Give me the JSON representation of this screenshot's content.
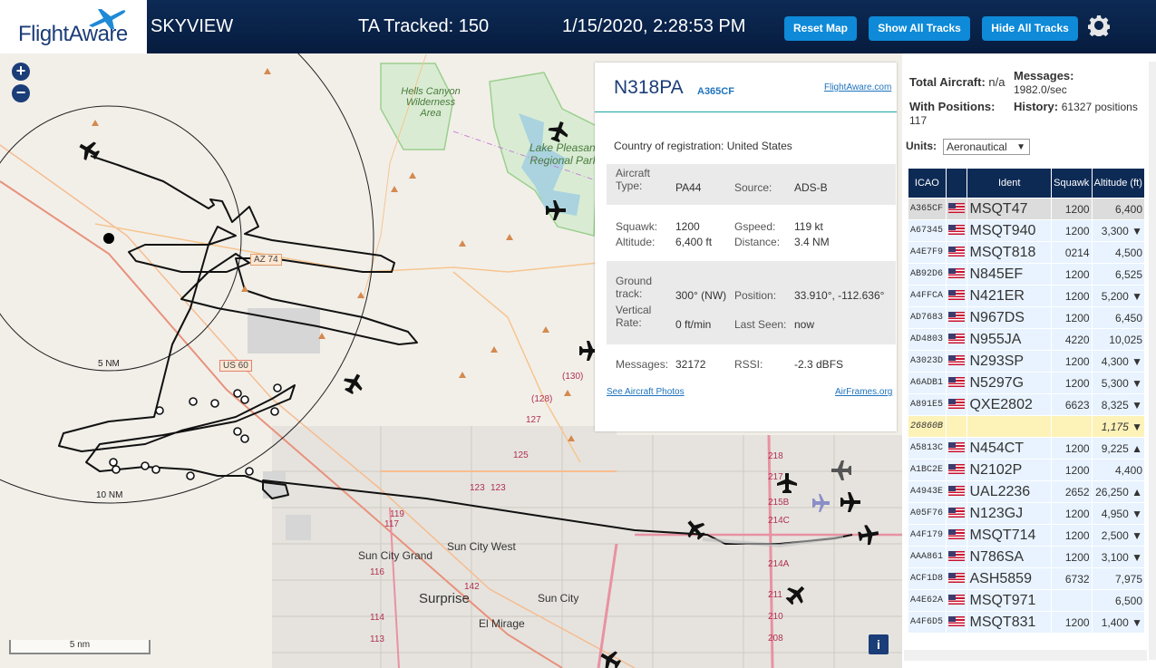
{
  "header": {
    "logo_text": "FlightAware",
    "app_name": "SKYVIEW",
    "tracked": "TA Tracked: 150",
    "datetime": "1/15/2020, 2:28:53 PM",
    "buttons": {
      "reset": "Reset Map",
      "show": "Show All Tracks",
      "hide": "Hide All Tracks"
    }
  },
  "map": {
    "zoom_in": "+",
    "zoom_out": "−",
    "labels": {
      "hells_canyon": "Hells Canyon Wilderness Area",
      "lake_pleasant": "Lake Pleasant Regional Park",
      "az74": "AZ 74",
      "us60": "US 60",
      "ring5": "5 NM",
      "ring10": "10 NM",
      "sun_city_grand": "Sun City Grand",
      "sun_city_west": "Sun City West",
      "surprise": "Surprise",
      "sun_city": "Sun City",
      "el_mirage": "El Mirage",
      "r128": "(128)",
      "r130": "(130)",
      "r127": "127",
      "r125": "125",
      "r123a": "123",
      "r123b": "123",
      "r119": "119",
      "r117": "117",
      "r116": "116",
      "r114": "114",
      "r113": "113",
      "r142": "142",
      "r218": "218",
      "r217": "217",
      "r215b": "215B",
      "r214c": "214C",
      "r214a": "214A",
      "r211": "211",
      "r210": "210",
      "r208": "208"
    },
    "scale": "5 nm",
    "info": "i"
  },
  "popup": {
    "callsign": "N318PA",
    "icao": "A365CF",
    "link_fa": "FlightAware.com",
    "country_label": "Country of registration:",
    "country": "United States",
    "type_label": "Aircraft Type:",
    "type": "PA44",
    "source_label": "Source:",
    "source": "ADS-B",
    "squawk_label": "Squawk:",
    "squawk": "1200",
    "gspeed_label": "Gspeed:",
    "gspeed": "119 kt",
    "altitude_label": "Altitude:",
    "altitude": "6,400 ft",
    "distance_label": "Distance:",
    "distance": "3.4 NM",
    "track_label": "Ground track:",
    "track": "300° (NW)",
    "position_label": "Position:",
    "position": "33.910°, -112.636°",
    "vrate_label": "Vertical Rate:",
    "vrate": "0 ft/min",
    "lastseen_label": "Last Seen:",
    "lastseen": "now",
    "messages_label": "Messages:",
    "messages": "32172",
    "rssi_label": "RSSI:",
    "rssi": "-2.3 dBFS",
    "photos_link": "See Aircraft Photos",
    "airframes_link": "AirFrames.org"
  },
  "sidebar": {
    "total_label": "Total Aircraft:",
    "total": "n/a",
    "messages_label": "Messages:",
    "messages": "1982.0/sec",
    "withpos_label": "With Positions:",
    "withpos": "117",
    "history_label": "History:",
    "history": "61327 positions",
    "units_label": "Units:",
    "units_value": "Aeronautical",
    "columns": [
      "ICAO",
      "",
      "Ident",
      "Squawk",
      "Altitude (ft)"
    ],
    "rows": [
      {
        "icao": "A365CF",
        "ident": "MSQT47",
        "squawk": "1200",
        "alt": "6,400"
      },
      {
        "icao": "A67345",
        "ident": "MSQT940",
        "squawk": "1200",
        "alt": "3,300 ▼"
      },
      {
        "icao": "A4E7F9",
        "ident": "MSQT818",
        "squawk": "0214",
        "alt": "4,500"
      },
      {
        "icao": "AB92D6",
        "ident": "N845EF",
        "squawk": "1200",
        "alt": "6,525"
      },
      {
        "icao": "A4FFCA",
        "ident": "N421ER",
        "squawk": "1200",
        "alt": "5,200 ▼"
      },
      {
        "icao": "AD7683",
        "ident": "N967DS",
        "squawk": "1200",
        "alt": "6,450"
      },
      {
        "icao": "AD4803",
        "ident": "N955JA",
        "squawk": "4220",
        "alt": "10,025"
      },
      {
        "icao": "A3023D",
        "ident": "N293SP",
        "squawk": "1200",
        "alt": "4,300 ▼"
      },
      {
        "icao": "A6ADB1",
        "ident": "N5297G",
        "squawk": "1200",
        "alt": "5,300 ▼"
      },
      {
        "icao": "A891E5",
        "ident": "QXE2802",
        "squawk": "6623",
        "alt": "8,325 ▼"
      },
      {
        "icao": "26860B",
        "ident": "",
        "squawk": "",
        "alt": "1,175 ▼"
      },
      {
        "icao": "A5813C",
        "ident": "N454CT",
        "squawk": "1200",
        "alt": "9,225 ▲"
      },
      {
        "icao": "A1BC2E",
        "ident": "N2102P",
        "squawk": "1200",
        "alt": "4,400"
      },
      {
        "icao": "A4943E",
        "ident": "UAL2236",
        "squawk": "2652",
        "alt": "26,250 ▲"
      },
      {
        "icao": "A05F76",
        "ident": "N123GJ",
        "squawk": "1200",
        "alt": "4,950 ▼"
      },
      {
        "icao": "A4F179",
        "ident": "MSQT714",
        "squawk": "1200",
        "alt": "2,500 ▼"
      },
      {
        "icao": "AAA861",
        "ident": "N786SA",
        "squawk": "1200",
        "alt": "3,100 ▼"
      },
      {
        "icao": "ACF1D8",
        "ident": "ASH5859",
        "squawk": "6732",
        "alt": "7,975"
      },
      {
        "icao": "A4E62A",
        "ident": "MSQT971",
        "squawk": "",
        "alt": "6,500"
      },
      {
        "icao": "A4F6D5",
        "ident": "MSQT831",
        "squawk": "1200",
        "alt": "1,400 ▼"
      }
    ]
  }
}
